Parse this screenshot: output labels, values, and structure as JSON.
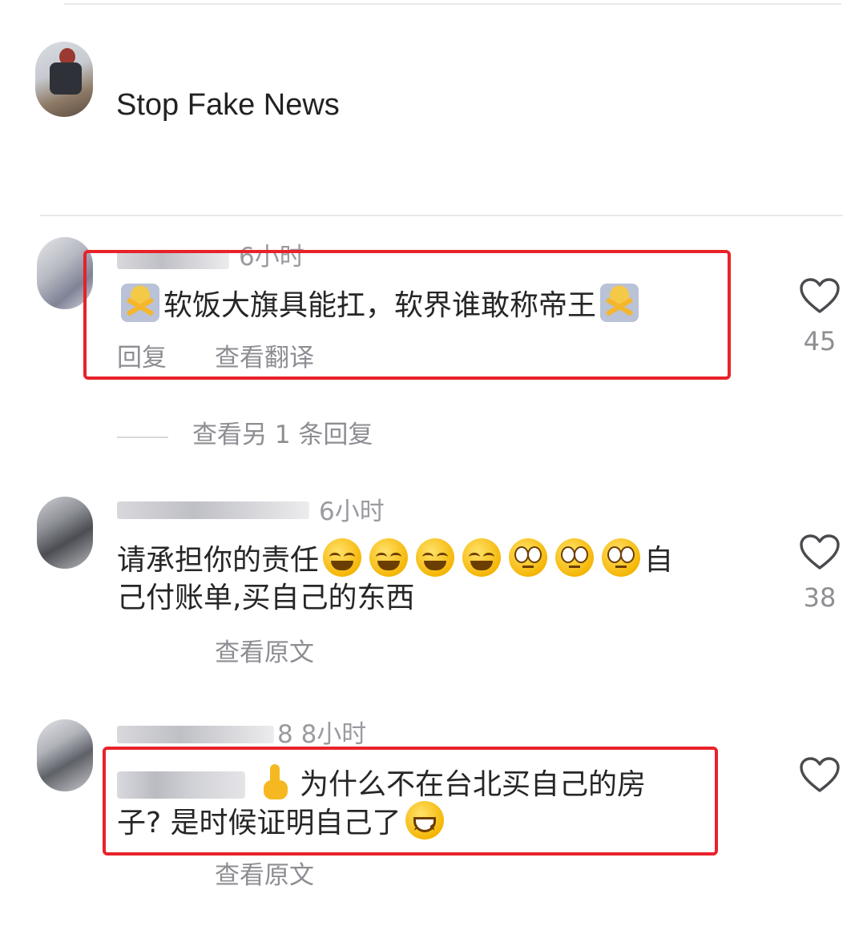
{
  "post": {
    "title": "Stop Fake News"
  },
  "comments": [
    {
      "time": "6小时",
      "text": "软饭大旗具能扛，软界谁敢称帝王",
      "actions": [
        "回复",
        "查看翻译"
      ],
      "likes": "45",
      "view_replies": "查看另 1 条回复",
      "emoji": [
        "person-gesturing-no",
        "person-gesturing-no"
      ]
    },
    {
      "time": "6小时",
      "text_before": "请承担你的责任",
      "text_after_line1": "自",
      "text_line2": "己付账单,买自己的东西",
      "actions": [
        "查看原文"
      ],
      "likes": "38",
      "emoji": [
        "face-with-tears-of-joy",
        "face-with-tears-of-joy",
        "face-with-tears-of-joy",
        "face-with-tears-of-joy",
        "face-with-rolling-eyes",
        "face-with-rolling-eyes",
        "face-with-rolling-eyes"
      ]
    },
    {
      "time": "8 8小时",
      "line1": "为什么不在台北买自己的房",
      "line2": "子? 是时候证明自己了",
      "actions": [
        "查看原文"
      ],
      "likes": "",
      "emoji": [
        "backhand-index-pointing-up",
        "grinning-squinting-face"
      ]
    }
  ],
  "colors": {
    "highlight_box": "#e8222a",
    "muted_text": "#8d8d93",
    "main_text": "#262626"
  },
  "icons": {
    "like": "heart-outline-icon"
  }
}
